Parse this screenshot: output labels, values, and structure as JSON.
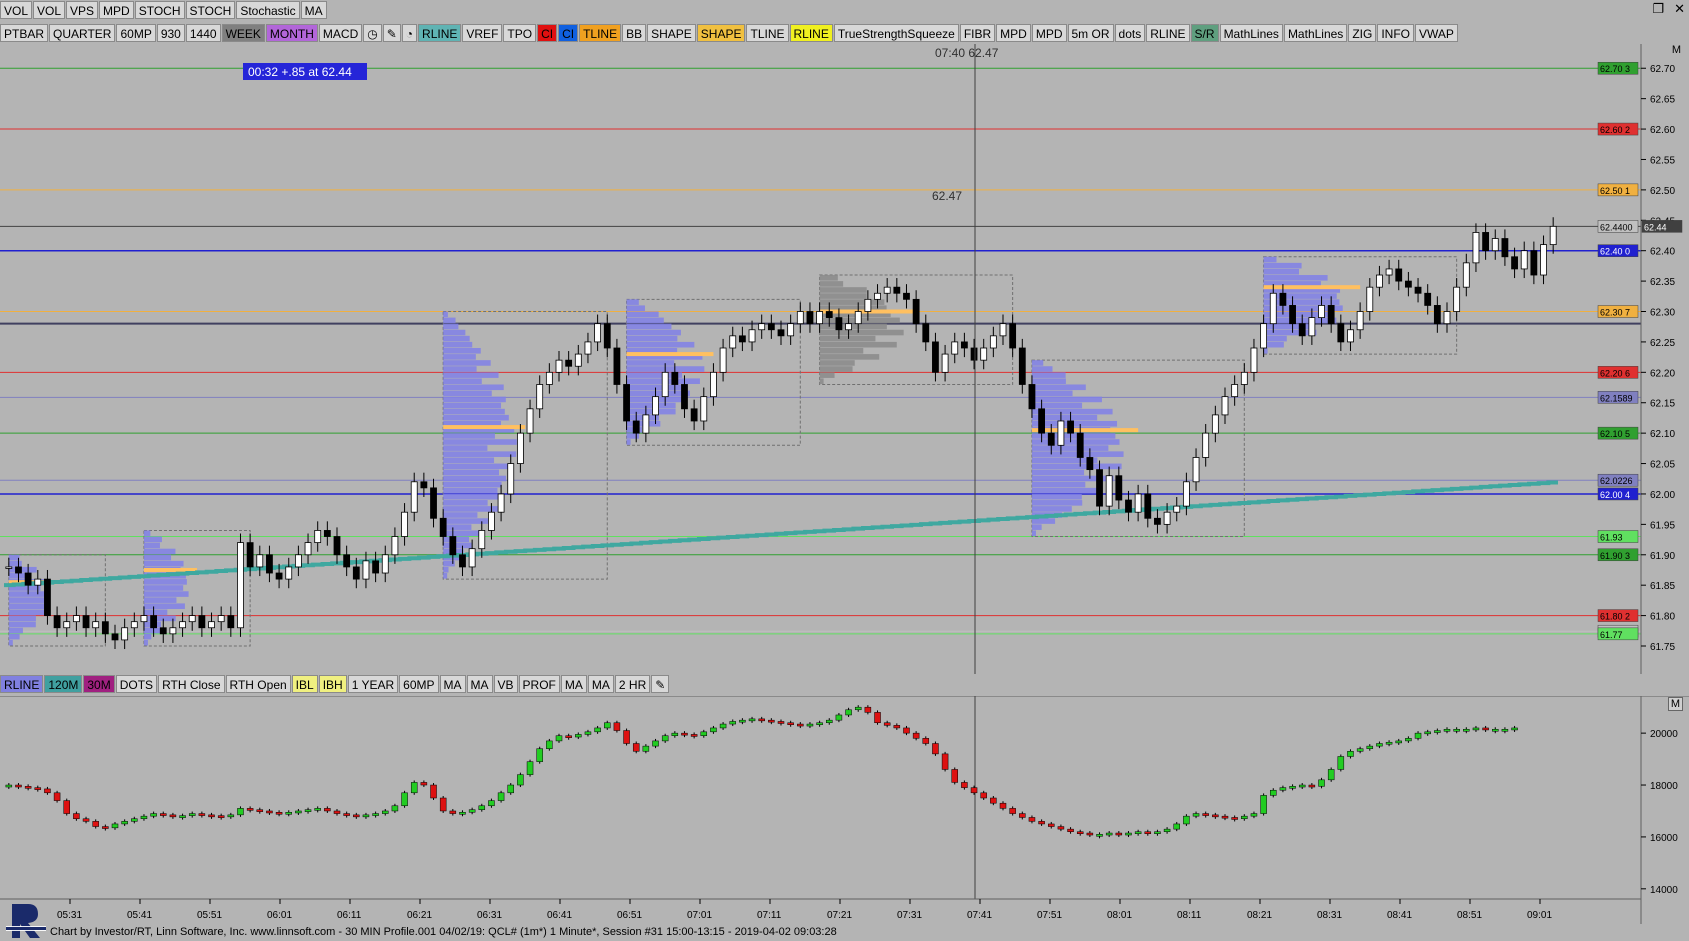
{
  "toolbar_top": [
    "VOL",
    "VOL",
    "VPS",
    "MPD",
    "STOCH",
    "STOCH",
    "Stochastic",
    "MA"
  ],
  "toolbar_second": [
    {
      "label": "PTBAR",
      "bg": "#d8d8d8"
    },
    {
      "label": "QUARTER",
      "bg": "#d8d8d8"
    },
    {
      "label": "60MP",
      "bg": "#d8d8d8"
    },
    {
      "label": "930",
      "bg": "#d8d8d8"
    },
    {
      "label": "1440",
      "bg": "#d8d8d8"
    },
    {
      "label": "WEEK",
      "bg": "#808080"
    },
    {
      "label": "MONTH",
      "bg": "#b266d9"
    },
    {
      "label": "MACD",
      "bg": "#d8d8d8"
    },
    {
      "label": "",
      "bg": "#d8d8d8",
      "icon": "clock-icon"
    },
    {
      "label": "",
      "bg": "#d8d8d8",
      "icon": "pencil-icon"
    },
    {
      "label": "",
      "bg": "#d8d8d8",
      "icon": "timer-icon"
    },
    {
      "label": "RLINE",
      "bg": "#5fb3b3"
    },
    {
      "label": "VREF",
      "bg": "#d8d8d8"
    },
    {
      "label": "TPO",
      "bg": "#d8d8d8"
    },
    {
      "label": "CI",
      "bg": "#e01010"
    },
    {
      "label": "CI",
      "bg": "#1060e0"
    },
    {
      "label": "TLINE",
      "bg": "#f0a020"
    },
    {
      "label": "BB",
      "bg": "#d8d8d8"
    },
    {
      "label": "SHAPE",
      "bg": "#d8d8d8"
    },
    {
      "label": "SHAPE",
      "bg": "#f0c040"
    },
    {
      "label": "TLINE",
      "bg": "#d8d8d8"
    },
    {
      "label": "RLINE",
      "bg": "#f0f020"
    },
    {
      "label": "TrueStrengthSqueeze",
      "bg": "#d8d8d8"
    },
    {
      "label": "FIBR",
      "bg": "#d8d8d8"
    },
    {
      "label": "MPD",
      "bg": "#d8d8d8"
    },
    {
      "label": "MPD",
      "bg": "#d8d8d8"
    },
    {
      "label": "5m OR",
      "bg": "#d8d8d8"
    },
    {
      "label": "dots",
      "bg": "#d8d8d8"
    },
    {
      "label": "RLINE",
      "bg": "#d8d8d8"
    },
    {
      "label": "S/R",
      "bg": "#5f9f7f"
    },
    {
      "label": "MathLines",
      "bg": "#d8d8d8"
    },
    {
      "label": "MathLines",
      "bg": "#d8d8d8"
    },
    {
      "label": "ZIG",
      "bg": "#d8d8d8"
    },
    {
      "label": "INFO",
      "bg": "#d8d8d8"
    },
    {
      "label": "VWAP",
      "bg": "#d8d8d8"
    }
  ],
  "toolbar_bottom": [
    {
      "label": "RLINE",
      "bg": "#8080e0"
    },
    {
      "label": "120M",
      "bg": "#40a0a0"
    },
    {
      "label": "30M",
      "bg": "#a02080"
    },
    {
      "label": "DOTS",
      "bg": "#d8d8d8"
    },
    {
      "label": "RTH Close",
      "bg": "#d8d8d8"
    },
    {
      "label": "RTH Open",
      "bg": "#d8d8d8"
    },
    {
      "label": "IBL",
      "bg": "#f0f080"
    },
    {
      "label": "IBH",
      "bg": "#f0f080"
    },
    {
      "label": "1 YEAR",
      "bg": "#d8d8d8"
    },
    {
      "label": "60MP",
      "bg": "#d8d8d8"
    },
    {
      "label": "MA",
      "bg": "#d8d8d8"
    },
    {
      "label": "MA",
      "bg": "#d8d8d8"
    },
    {
      "label": "VB",
      "bg": "#d8d8d8"
    },
    {
      "label": "PROF",
      "bg": "#d8d8d8"
    },
    {
      "label": "MA",
      "bg": "#d8d8d8"
    },
    {
      "label": "MA",
      "bg": "#d8d8d8"
    },
    {
      "label": "2 HR",
      "bg": "#d8d8d8"
    },
    {
      "label": "",
      "bg": "#d8d8d8",
      "icon": "pencil-icon"
    }
  ],
  "info_box": "00:32  +.85 at 62.44",
  "cursor_label": "07:40  62.47",
  "high_label": "62.47",
  "status_bar": "Chart by Investor/RT, Linn Software, Inc. www.linnsoft.com - 30 MIN Profile.001  04/02/19: QCL# (1m*) 1 Minute*, Session #31 15:00-13:15 - 2019-04-02 09:03:28",
  "main_panel_label": "M",
  "ind_panel_label": "M",
  "colors": {
    "bull": "#ffffff",
    "bear": "#000000",
    "profile": "#8080e8",
    "poc": "#ffc060",
    "vwap": "#3fa8a0",
    "green_bar": "#22cc22",
    "red_bar": "#dd1111"
  },
  "chart_data": [
    {
      "type": "candlestick",
      "title": "",
      "ylim": [
        61.75,
        62.73
      ],
      "y_ticks": [
        "62.70",
        "62.65",
        "62.60",
        "62.55",
        "62.50",
        "62.45",
        "62.40",
        "62.35",
        "62.30",
        "62.25",
        "62.20",
        "62.15",
        "62.10",
        "62.05",
        "62.00",
        "61.95",
        "61.90",
        "61.85",
        "61.80",
        "61.75"
      ],
      "x_ticks": [
        "05:31",
        "05:41",
        "05:51",
        "06:01",
        "06:11",
        "06:21",
        "06:31",
        "06:41",
        "06:51",
        "07:01",
        "07:11",
        "07:21",
        "07:31",
        "07:41",
        "07:51",
        "08:01",
        "08:11",
        "08:21",
        "08:31",
        "08:41",
        "08:51",
        "09:01"
      ],
      "price_tags": [
        {
          "text": "62.70 3",
          "value": 62.7,
          "color": "#30a030"
        },
        {
          "text": "62.60 2",
          "value": 62.6,
          "color": "#e03030"
        },
        {
          "text": "62.50 1",
          "value": 62.5,
          "color": "#f0b040"
        },
        {
          "text": "62.4400",
          "value": 62.44,
          "color": "#c0c0c0"
        },
        {
          "text": "62.44",
          "value": 62.44,
          "color": "#404040"
        },
        {
          "text": "62.40 0",
          "value": 62.4,
          "color": "#2020d0"
        },
        {
          "text": "62.30 7",
          "value": 62.3,
          "color": "#f0b040"
        },
        {
          "text": "62.20 6",
          "value": 62.2,
          "color": "#e03030"
        },
        {
          "text": "62.1589",
          "value": 62.1589,
          "color": "#8080c0"
        },
        {
          "text": "62.10 5",
          "value": 62.1,
          "color": "#30a030"
        },
        {
          "text": "62.0226",
          "value": 62.0226,
          "color": "#8080c0"
        },
        {
          "text": "62.00 4",
          "value": 62.0,
          "color": "#2020d0"
        },
        {
          "text": "61.93",
          "value": 61.93,
          "color": "#60e060"
        },
        {
          "text": "61.90 3",
          "value": 61.9,
          "color": "#30a030"
        },
        {
          "text": "61.80 2",
          "value": 61.8,
          "color": "#e03030"
        },
        {
          "text": "61.7743",
          "value": 61.7743,
          "color": "#c0c0c0"
        },
        {
          "text": "61.77",
          "value": 61.77,
          "color": "#60e060"
        }
      ],
      "closes": [
        61.88,
        61.87,
        61.85,
        61.86,
        61.8,
        61.78,
        61.79,
        61.8,
        61.78,
        61.79,
        61.77,
        61.76,
        61.78,
        61.79,
        61.8,
        61.78,
        61.77,
        61.78,
        61.79,
        61.8,
        61.78,
        61.79,
        61.8,
        61.78,
        61.92,
        61.88,
        61.9,
        61.87,
        61.86,
        61.88,
        61.9,
        61.92,
        61.94,
        61.93,
        61.9,
        61.88,
        61.86,
        61.89,
        61.87,
        61.9,
        61.93,
        61.97,
        62.02,
        62.01,
        61.96,
        61.93,
        61.9,
        61.88,
        61.91,
        61.94,
        61.97,
        62.0,
        62.05,
        62.1,
        62.14,
        62.18,
        62.2,
        62.22,
        62.21,
        62.23,
        62.25,
        62.28,
        62.24,
        62.18,
        62.12,
        62.1,
        62.13,
        62.16,
        62.2,
        62.18,
        62.14,
        62.12,
        62.16,
        62.2,
        62.24,
        62.26,
        62.25,
        62.27,
        62.28,
        62.27,
        62.26,
        62.28,
        62.3,
        62.28,
        62.3,
        62.29,
        62.27,
        62.28,
        62.3,
        62.32,
        62.33,
        62.34,
        62.33,
        62.32,
        62.28,
        62.25,
        62.2,
        62.23,
        62.25,
        62.24,
        62.22,
        62.24,
        62.26,
        62.28,
        62.24,
        62.18,
        62.14,
        62.1,
        62.08,
        62.12,
        62.1,
        62.06,
        62.04,
        61.98,
        62.03,
        61.99,
        61.97,
        62.0,
        61.96,
        61.95,
        61.97,
        61.98,
        62.02,
        62.06,
        62.1,
        62.13,
        62.16,
        62.18,
        62.2,
        62.24,
        62.28,
        62.33,
        62.31,
        62.28,
        62.26,
        62.29,
        62.31,
        62.28,
        62.25,
        62.27,
        62.3,
        62.34,
        62.36,
        62.37,
        62.35,
        62.34,
        62.33,
        62.31,
        62.28,
        62.3,
        62.34,
        62.38,
        62.43,
        62.4,
        62.42,
        62.39,
        62.37,
        62.4,
        62.36,
        62.41,
        62.44
      ],
      "series_names": []
    },
    {
      "type": "bar",
      "title": "",
      "ylim": [
        13800,
        21200
      ],
      "y_ticks": [
        "20000",
        "18000",
        "16000",
        "14000"
      ],
      "values": [
        18000,
        17950,
        17900,
        17850,
        17700,
        17400,
        16900,
        16700,
        16600,
        16400,
        16350,
        16500,
        16600,
        16700,
        16800,
        16900,
        16850,
        16800,
        16820,
        16900,
        16850,
        16820,
        16800,
        16850,
        17100,
        17050,
        17000,
        16950,
        16900,
        16950,
        17000,
        17050,
        17100,
        17000,
        16900,
        16850,
        16800,
        16850,
        16900,
        17000,
        17200,
        17700,
        18100,
        18000,
        17500,
        17000,
        16900,
        16950,
        17050,
        17200,
        17400,
        17700,
        18000,
        18400,
        18900,
        19400,
        19700,
        19900,
        19850,
        19950,
        20050,
        20200,
        20400,
        20100,
        19600,
        19300,
        19500,
        19700,
        19900,
        20000,
        19950,
        19900,
        20050,
        20200,
        20350,
        20450,
        20500,
        20550,
        20500,
        20450,
        20400,
        20350,
        20300,
        20350,
        20400,
        20500,
        20700,
        20900,
        21000,
        20800,
        20400,
        20300,
        20200,
        20000,
        19800,
        19600,
        19200,
        18600,
        18100,
        17900,
        17700,
        17500,
        17300,
        17100,
        16900,
        16750,
        16600,
        16500,
        16400,
        16300,
        16200,
        16150,
        16100,
        16100,
        16150,
        16100,
        16150,
        16200,
        16150,
        16200,
        16300,
        16500,
        16800,
        16900,
        16850,
        16800,
        16750,
        16700,
        16800,
        16900,
        17600,
        17800,
        17900,
        17950,
        18000,
        17950,
        18200,
        18600,
        19100,
        19300,
        19400,
        19500,
        19600,
        19650,
        19700,
        19800,
        20000,
        20050,
        20100,
        20150,
        20150,
        20150,
        20200,
        20150,
        20150,
        20150,
        20200
      ],
      "series_names": []
    }
  ]
}
